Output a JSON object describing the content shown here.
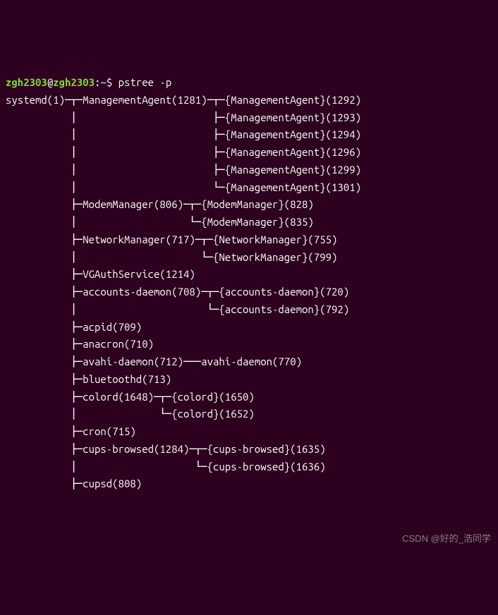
{
  "prompt": {
    "user": "zgh2303",
    "at": "@",
    "host": "zgh2303",
    "colon": ":",
    "path": "~",
    "dollar": "$ ",
    "command": "pstree -p"
  },
  "lines": [
    "systemd(1)─┬─ManagementAgent(1281)─┬─{ManagementAgent}(1292)",
    "           │                       ├─{ManagementAgent}(1293)",
    "           │                       ├─{ManagementAgent}(1294)",
    "           │                       ├─{ManagementAgent}(1296)",
    "           │                       ├─{ManagementAgent}(1299)",
    "           │                       └─{ManagementAgent}(1301)",
    "           ├─ModemManager(806)─┬─{ModemManager}(828)",
    "           │                   └─{ModemManager}(835)",
    "           ├─NetworkManager(717)─┬─{NetworkManager}(755)",
    "           │                     └─{NetworkManager}(799)",
    "           ├─VGAuthService(1214)",
    "           ├─accounts-daemon(708)─┬─{accounts-daemon}(720)",
    "           │                      └─{accounts-daemon}(792)",
    "           ├─acpid(709)",
    "           ├─anacron(710)",
    "           ├─avahi-daemon(712)───avahi-daemon(770)",
    "           ├─bluetoothd(713)",
    "           ├─colord(1648)─┬─{colord}(1650)",
    "           │              └─{colord}(1652)",
    "           ├─cron(715)",
    "           ├─cups-browsed(1284)─┬─{cups-browsed}(1635)",
    "           │                    └─{cups-browsed}(1636)",
    "           ├─cupsd(808)"
  ],
  "watermark": "CSDN @好的_浩同学"
}
